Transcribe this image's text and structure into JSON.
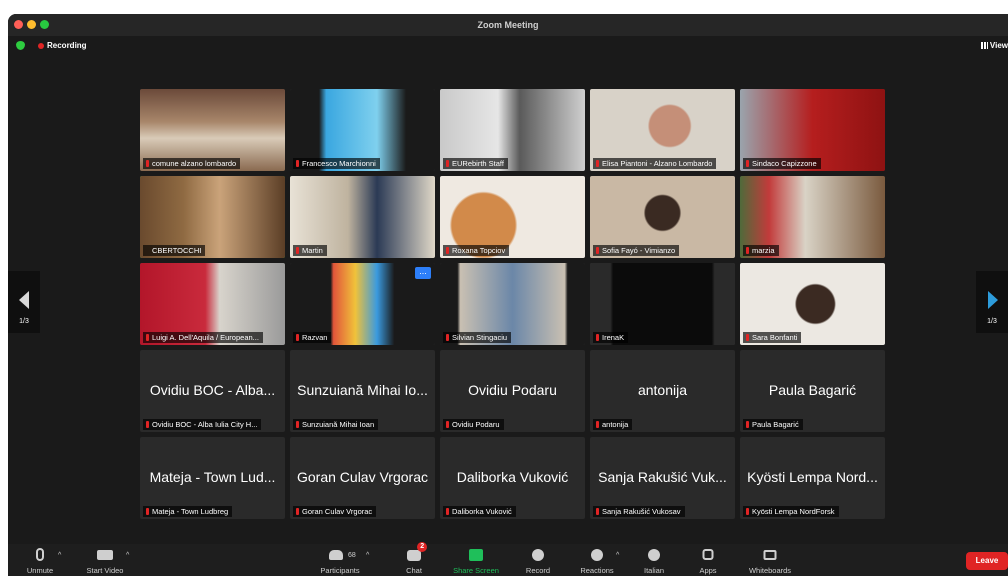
{
  "app": {
    "title": "Zoom Meeting"
  },
  "status": {
    "recording_label": "Recording",
    "view_label": "View"
  },
  "nav": {
    "page_left": "1/3",
    "page_right": "1/3"
  },
  "tiles": [
    {
      "name": "comune alzano lombardo"
    },
    {
      "name": "Francesco Marchionni"
    },
    {
      "name": "EURebirth Staff"
    },
    {
      "name": "Elisa Piantoni - Alzano Lombardo"
    },
    {
      "name": "Sindaco Capizzone"
    },
    {
      "name": "CBERTOCCHI"
    },
    {
      "name": "Martin"
    },
    {
      "name": "Roxana Topciov"
    },
    {
      "name": "Sofia Fayó - Vimianzo"
    },
    {
      "name": "marzia"
    },
    {
      "name": "Luigi A. Dell'Aquila / European..."
    },
    {
      "name": "Razvan"
    },
    {
      "name": "Silvian Stingaciu"
    },
    {
      "name": "IrenaK"
    },
    {
      "name": "Sara Bonfanti"
    },
    {
      "display": "Ovidiu BOC - Alba...",
      "name": "Ovidiu BOC - Alba Iulia City H..."
    },
    {
      "display": "Sunzuiană Mihai Io...",
      "name": "Sunzuiană Mihai Ioan"
    },
    {
      "display": "Ovidiu Podaru",
      "name": "Ovidiu Podaru"
    },
    {
      "display": "antonija",
      "name": "antonija"
    },
    {
      "display": "Paula Bagarić",
      "name": "Paula Bagarić"
    },
    {
      "display": "Mateja - Town Lud...",
      "name": "Mateja - Town Ludbreg"
    },
    {
      "display": "Goran Culav Vrgorac",
      "name": "Goran Culav Vrgorac"
    },
    {
      "display": "Daliborka Vuković",
      "name": "Daliborka Vuković"
    },
    {
      "display": "Sanja Rakušić Vuk...",
      "name": "Sanja Rakušić Vukosav"
    },
    {
      "display": "Kyösti Lempa Nord...",
      "name": "Kyösti Lempa NordForsk"
    }
  ],
  "more_options": "...",
  "toolbar": {
    "unmute": "Unmute",
    "start_video": "Start Video",
    "participants": "Participants",
    "participants_count": "68",
    "chat": "Chat",
    "chat_badge": "2",
    "share_screen": "Share Screen",
    "record": "Record",
    "reactions": "Reactions",
    "italian": "Italian",
    "apps": "Apps",
    "whiteboards": "Whiteboards",
    "leave": "Leave"
  },
  "colors": {
    "accent_green": "#2fbf4a",
    "recording_red": "#e02424",
    "share_green": "#1fbf5a",
    "nav_blue": "#2d9cdb"
  }
}
